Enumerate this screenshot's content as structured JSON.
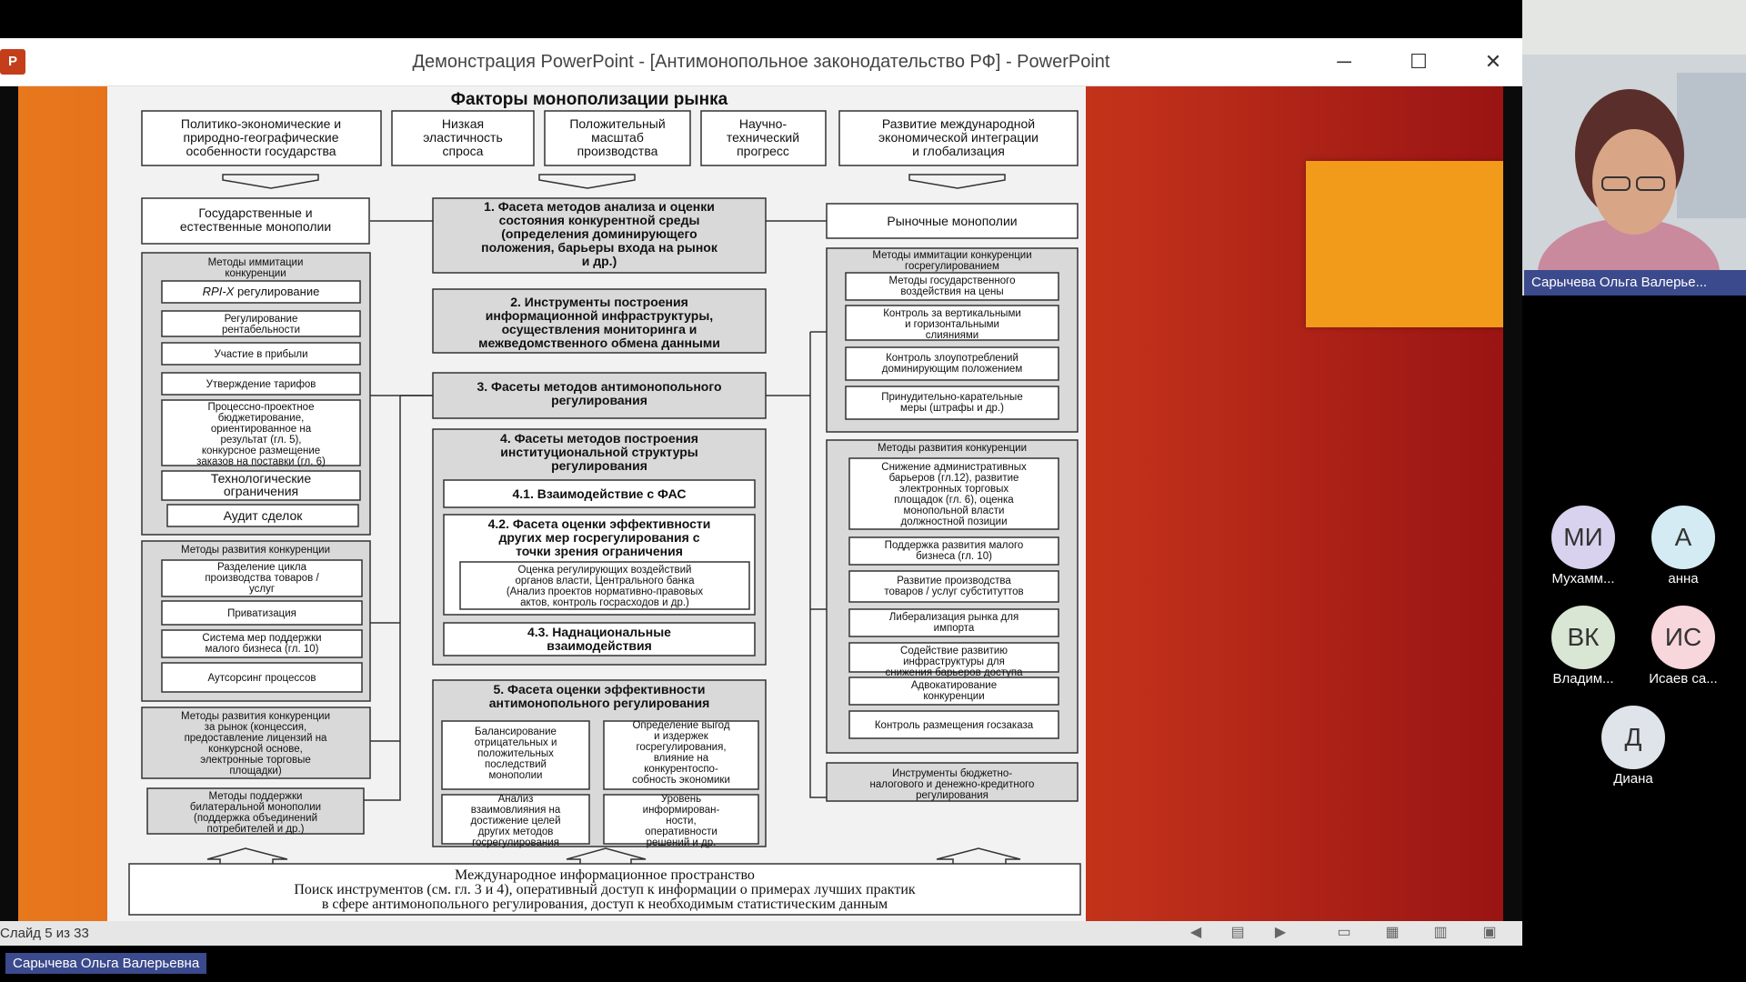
{
  "window": {
    "title": "Демонстрация PowerPoint - [Антимонопольное законодательство РФ] - PowerPoint",
    "app_icon": "P",
    "minimize": "─",
    "maximize": "☐",
    "close": "✕"
  },
  "slide": {
    "title": "Факторы монополизации рынка",
    "top_factors": [
      "Политико-экономические и природно-географические особенности государства",
      "Низкая эластичность спроса",
      "Положительный масштаб производства",
      "Научно-технический прогресс",
      "Развитие международной экономической интеграции и глобализация"
    ],
    "left_header": "Государственные и естественные монополии",
    "left_imitation": {
      "title": "Методы иммитации конкуренции",
      "items": [
        "RPI-X регулирование",
        "Регулирование рентабельности",
        "Участие в прибыли",
        "Утверждение тарифов",
        "Процессно-проектное бюджетирование, ориентированное на результат (гл. 5), конкурсное размещение заказов на поставки (гл. 6)",
        "Технологические ограничения",
        "Аудит сделок"
      ]
    },
    "left_development": {
      "title": "Методы развития конкуренции",
      "items": [
        "Разделение цикла производства товаров / услуг",
        "Приватизация",
        "Система мер поддержки малого бизнеса (гл. 10)",
        "Аутсорсинг процессов"
      ]
    },
    "left_market": "Методы развития конкуренции за рынок (концессия, предоставление лицензий на конкурсной основе, электронные торговые площадки)",
    "left_bilateral": "Методы поддержки билатеральной монополии (поддержка объединений потребителей и др.)",
    "center_boxes": [
      "1. Фасета методов анализа и оценки состояния конкурентной среды (определения доминирующего положения, барьеры входа на рынок и др.)",
      "2. Инструменты построения информационной инфраструктуры, осуществления мониторинга и межведомственного обмена данными",
      "3. Фасеты методов антимонопольного регулирования"
    ],
    "center_institutional": {
      "title": "4. Фасеты методов построения институциональной структуры регулирования",
      "b41": "4.1. Взаимодействие с ФАС",
      "b42": "4.2. Фасета оценки эффективности других мер госрегулирования с точки зрения ограничения",
      "b42_inner": "Оценка регулирующих воздействий органов власти, Центрального банка (Анализ проектов нормативно-правовых актов, контроль госрасходов и др.)",
      "b43": "4.3. Наднациональные взаимодействия"
    },
    "center_efficiency": {
      "title": "5. Фасета оценки эффективности антимонопольного регулирования",
      "items": [
        "Балансирование отрицательных и положительных последствий монополии",
        "Определение выгод и издержек госрегулирования, влияние на конкурентоспособность экономики",
        "Анализ взаимовлияния на достижение целей других методов госрегулирования",
        "Уровень информированности, оперативности решений и др."
      ]
    },
    "right_header": "Рыночные монополии",
    "right_imitation": {
      "title": "Методы иммитации конкуренции госрегулированием",
      "items": [
        "Методы государственного воздействия на цены",
        "Контроль за вертикальными и горизонтальными слияниями",
        "Контроль злоупотреблений доминирующим положением",
        "Принудительно-карательные меры (штрафы и др.)"
      ]
    },
    "right_development": {
      "title": "Методы развития конкуренции",
      "items": [
        "Снижение административных барьеров (гл.12), развитие электронных торговых площадок (гл. 6), оценка монопольной власти должностной позиции",
        "Поддержка развития малого бизнеса (гл. 10)",
        "Развитие производства товаров / услуг субституттов",
        "Либерализация рынка для импорта",
        "Содействие развитию инфраструктуры для снижения барьеров доступа",
        "Адвокатирование конкуренции",
        "Контроль размещения госзаказа"
      ]
    },
    "right_budget": "Инструменты бюджетно-налогового и денежно-кредитного регулирования",
    "bottom": {
      "line1": "Международное информационное пространство",
      "line2": "Поиск инструментов (см. гл. 3 и 4), оперативный доступ к информации о примерах лучших практик",
      "line3": "в сфере антимонопольного регулирования, доступ к необходимым статистическим данным"
    }
  },
  "statusbar": {
    "slide_counter": "Слайд 5 из 33",
    "icons": [
      "prev-icon",
      "notes-icon",
      "next-icon",
      "normal-view-icon",
      "sorter-view-icon",
      "reading-view-icon",
      "slideshow-icon"
    ]
  },
  "meeting": {
    "presenter_label": "Сарычева Ольга Валерьевна",
    "video_name": "Сарычева Ольга Валерье...",
    "participants": [
      {
        "initials": "МИ",
        "name": "Мухамм...",
        "color": "#d9d2ee"
      },
      {
        "initials": "А",
        "name": "анна",
        "color": "#d4ebf3"
      },
      {
        "initials": "ВК",
        "name": "Владим...",
        "color": "#d9e6d3"
      },
      {
        "initials": "ИС",
        "name": "Исаев са...",
        "color": "#f7d6dc"
      },
      {
        "initials": "Д",
        "name": "Диана",
        "color": "#dfe3ea"
      }
    ]
  }
}
